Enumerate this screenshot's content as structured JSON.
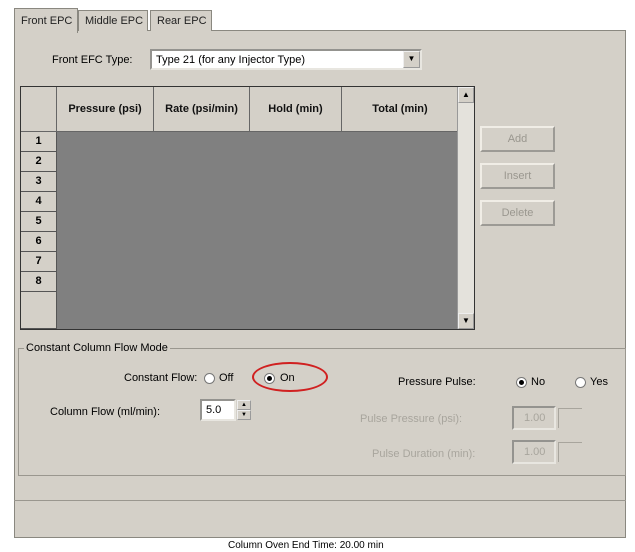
{
  "tabs": [
    "Front EPC",
    "Middle EPC",
    "Rear EPC"
  ],
  "efc_type": {
    "label": "Front EFC Type:",
    "value": "Type 21 (for any Injector Type)"
  },
  "grid": {
    "columns": [
      "Pressure (psi)",
      "Rate (psi/min)",
      "Hold (min)",
      "Total (min)"
    ],
    "rows": [
      "1",
      "2",
      "3",
      "4",
      "5",
      "6",
      "7",
      "8"
    ]
  },
  "side_buttons": [
    "Add",
    "Insert",
    "Delete"
  ],
  "mode_group": {
    "title": "Constant Column Flow Mode",
    "constant_flow_label": "Constant Flow:",
    "off_label": "Off",
    "on_label": "On",
    "constant_flow_selected": "On",
    "pressure_pulse_label": "Pressure Pulse:",
    "no_label": "No",
    "yes_label": "Yes",
    "pressure_pulse_selected": "No",
    "column_flow_label": "Column Flow (ml/min):",
    "column_flow_value": "5.0",
    "pulse_pressure_label": "Pulse Pressure (psi):",
    "pulse_pressure_value": "1.00",
    "pulse_duration_label": "Pulse Duration (min):",
    "pulse_duration_value": "1.00"
  },
  "footer": {
    "label": "Column Oven End Time:",
    "value": "20.00 min"
  },
  "colors": {
    "panel": "#d4d0c8",
    "grid_body": "#808080",
    "highlight": "#d02020"
  }
}
